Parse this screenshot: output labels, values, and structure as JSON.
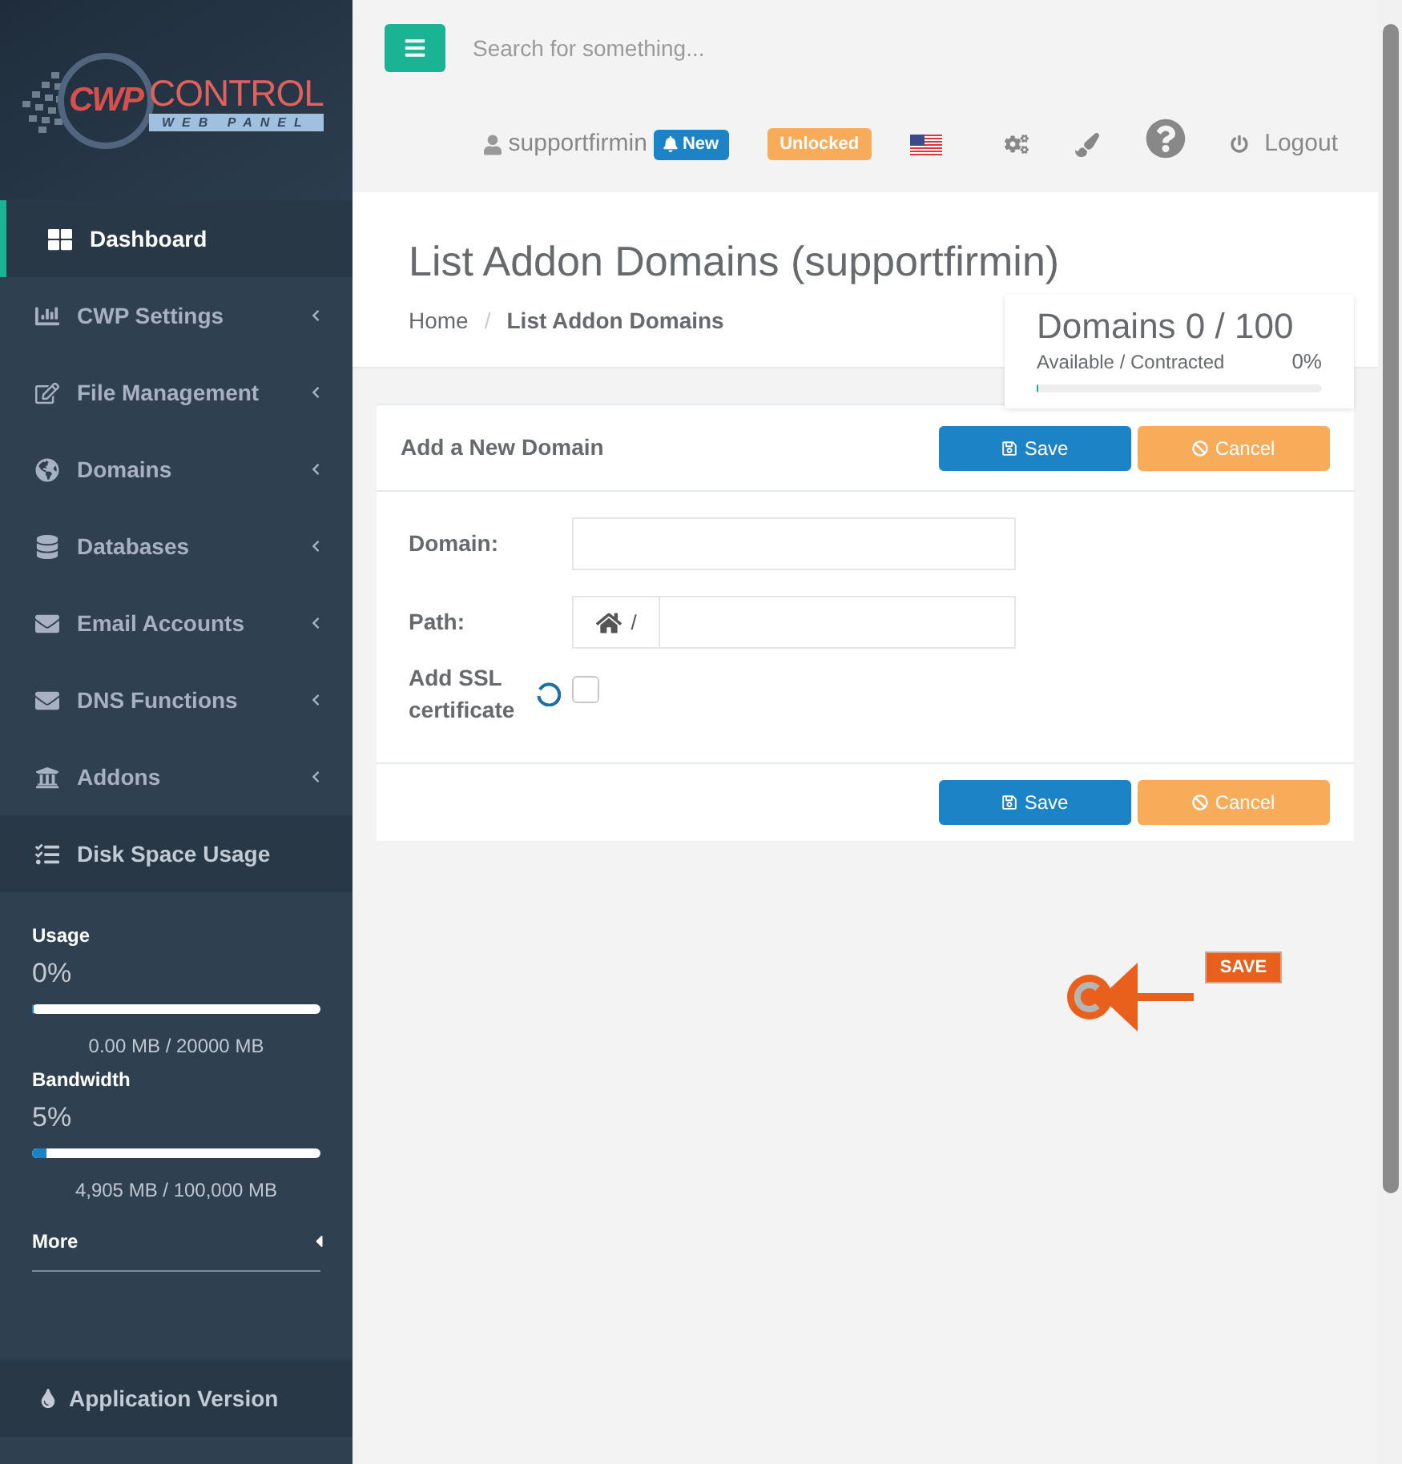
{
  "sidebar": {
    "logo": {
      "mark": "CWP",
      "name": "CONTROL",
      "tagline": "WEB PANEL"
    },
    "menu": [
      {
        "label": "Dashboard",
        "kind": "link",
        "selected": true
      },
      {
        "label": "CWP Settings",
        "kind": "submenu",
        "selected": false
      },
      {
        "label": "File Management",
        "kind": "submenu",
        "selected": false
      },
      {
        "label": "Domains",
        "kind": "submenu",
        "selected": false
      },
      {
        "label": "Databases",
        "kind": "submenu",
        "selected": false
      },
      {
        "label": "Email Accounts",
        "kind": "submenu",
        "selected": false
      },
      {
        "label": "DNS Functions",
        "kind": "submenu",
        "selected": false
      },
      {
        "label": "Addons",
        "kind": "submenu",
        "selected": false
      },
      {
        "label": "Disk Space Usage",
        "kind": "link",
        "selected": false
      }
    ],
    "meters": [
      {
        "label": "Usage",
        "percent": "0%",
        "level": 0,
        "detail": "0.00 MB / 20000 MB"
      },
      {
        "label": "Bandwidth",
        "percent": "5%",
        "level": 0.05,
        "detail": "4,905 MB / 100,000 MB"
      }
    ],
    "more": {
      "label": "More"
    },
    "footer": {
      "label": "Application Version"
    }
  },
  "topbar": {
    "search": {
      "placeholder": "Search for something..."
    },
    "user": {
      "name": "supportfirmin",
      "badge": "New"
    },
    "status_badge": "Unlocked",
    "logout": "Logout"
  },
  "page_header": {
    "title": "List Addon Domains (supportfirmin)",
    "breadcrumb": [
      {
        "label": "Home",
        "active": false
      },
      {
        "separator": "/",
        "label": "List Addon Domains",
        "active": true
      }
    ]
  },
  "domains_widget": {
    "title": "Domains 0 / 100",
    "caption": "Available / Contracted",
    "percent": "0%",
    "level": 0
  },
  "form": {
    "title": "Add a New Domain",
    "header_buttons": [
      {
        "kind": "save",
        "label": "Save"
      },
      {
        "kind": "cancel",
        "label": "Cancel"
      }
    ],
    "fields": [
      {
        "kind": "text",
        "label": "Domain:"
      },
      {
        "kind": "path",
        "label": "Path:",
        "prefix": "/"
      },
      {
        "kind": "checkbox",
        "label": "Add SSL certificate",
        "checked": false,
        "loading": true
      }
    ],
    "footer_buttons": [
      {
        "kind": "save",
        "label": "Save"
      },
      {
        "kind": "cancel",
        "label": "Cancel"
      }
    ]
  },
  "annotation": {
    "label": "SAVE"
  }
}
